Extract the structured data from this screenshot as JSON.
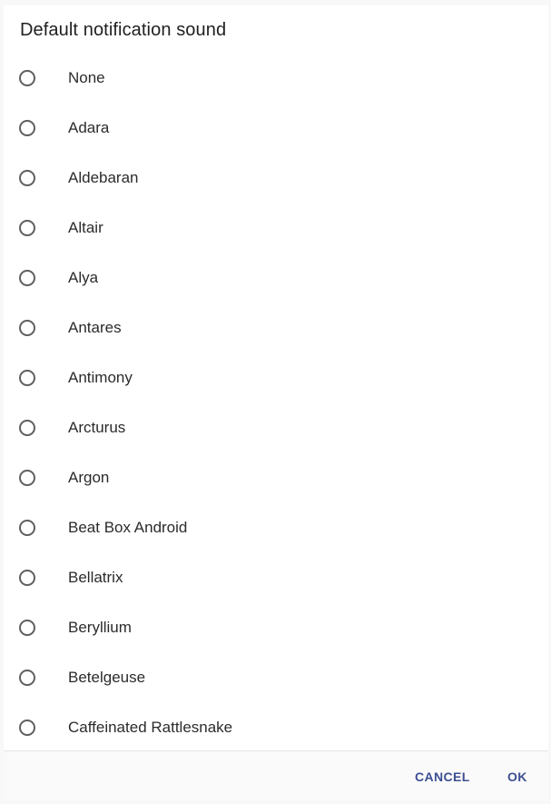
{
  "dialog": {
    "title": "Default notification sound",
    "options": [
      {
        "label": "None",
        "selected": false
      },
      {
        "label": "Adara",
        "selected": false
      },
      {
        "label": "Aldebaran",
        "selected": false
      },
      {
        "label": "Altair",
        "selected": false
      },
      {
        "label": "Alya",
        "selected": false
      },
      {
        "label": "Antares",
        "selected": false
      },
      {
        "label": "Antimony",
        "selected": false
      },
      {
        "label": "Arcturus",
        "selected": false
      },
      {
        "label": "Argon",
        "selected": false
      },
      {
        "label": "Beat Box Android",
        "selected": false
      },
      {
        "label": "Bellatrix",
        "selected": false
      },
      {
        "label": "Beryllium",
        "selected": false
      },
      {
        "label": "Betelgeuse",
        "selected": false
      },
      {
        "label": "Caffeinated Rattlesnake",
        "selected": false
      }
    ],
    "buttons": {
      "cancel_label": "CANCEL",
      "ok_label": "OK"
    }
  },
  "colors": {
    "accent": "#3d4f93",
    "radio_border": "#5f5f5f",
    "text": "#2b2b2b"
  },
  "icons": {
    "radio": "radio-unchecked-icon"
  }
}
